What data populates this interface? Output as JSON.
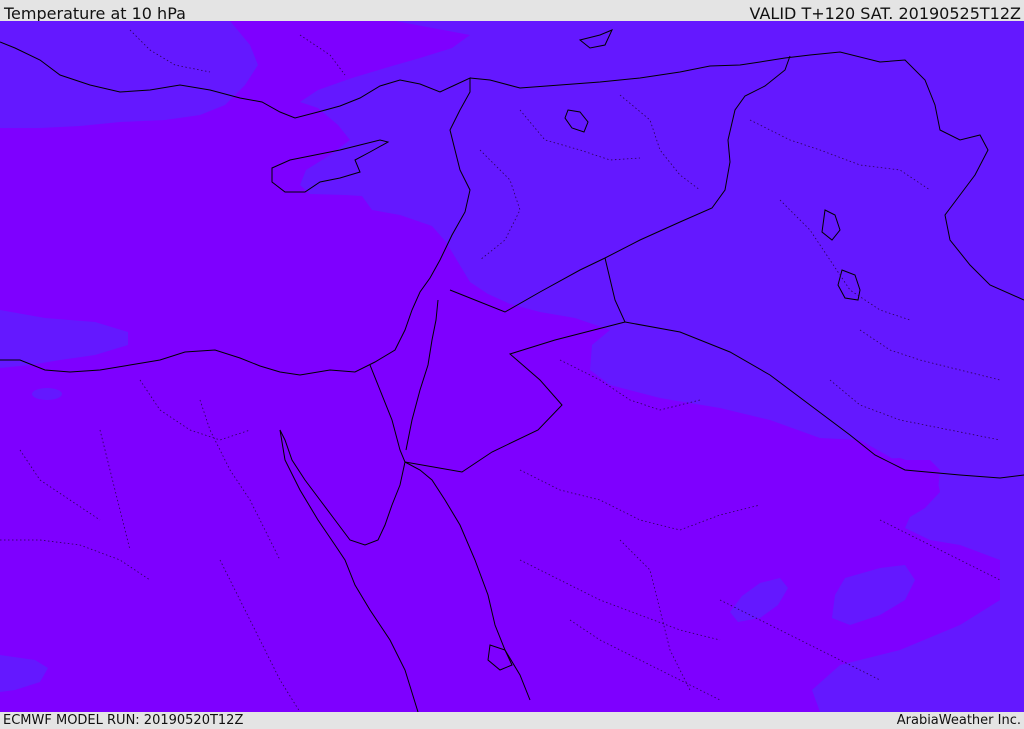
{
  "header": {
    "title": "Temperature at 10 hPa",
    "valid_time": "VALID T+120 SAT. 20190525T12Z"
  },
  "footer": {
    "model_run": "ECMWF MODEL RUN: 20190520T12Z",
    "credit": "ArabiaWeather Inc."
  },
  "map": {
    "colors": {
      "warmer_band": "#7e00ff",
      "cooler_band": "#6418ff",
      "coastline": "#000000",
      "internal_border": "#2a0050"
    }
  }
}
